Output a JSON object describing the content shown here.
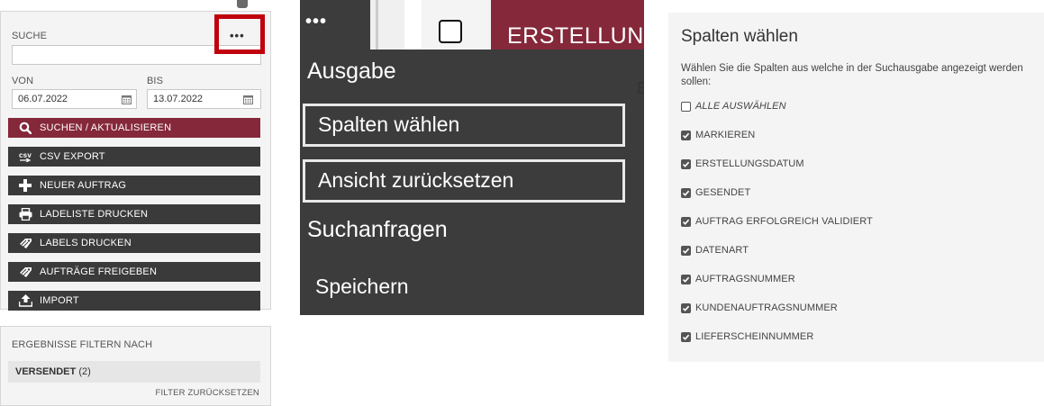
{
  "search_panel": {
    "search_label": "SUCHE",
    "menu_dots": "•••",
    "search_value": "",
    "from_label": "VON",
    "to_label": "BIS",
    "from_date": "06.07.2022",
    "to_date": "13.07.2022",
    "buttons": [
      {
        "label": "SUCHEN / AKTUALISIEREN",
        "icon": "search-icon"
      },
      {
        "label": "CSV EXPORT",
        "icon": "csv-icon"
      },
      {
        "label": "NEUER AUFTRAG",
        "icon": "plus-icon"
      },
      {
        "label": "LADELISTE DRUCKEN",
        "icon": "printer-icon"
      },
      {
        "label": "LABELS DRUCKEN",
        "icon": "label-icon"
      },
      {
        "label": "AUFTRÄGE FREIGEBEN",
        "icon": "label-icon"
      },
      {
        "label": "IMPORT",
        "icon": "upload-icon"
      }
    ],
    "csv_icon_text": "csv",
    "filter_heading": "ERGEBNISSE FILTERN NACH",
    "filter_item_label": "VERSENDET",
    "filter_item_count": "(2)",
    "filter_reset": "FILTER ZURÜCKSETZEN",
    "highlight_color": "#c0000c",
    "accent_color": "#85283a"
  },
  "context_menu": {
    "dots": "•••",
    "header_title": "ERSTELLUNG",
    "section_output": "Ausgabe",
    "item_choose_columns": "Spalten wählen",
    "item_reset_view": "Ansicht zurücksetzen",
    "section_queries": "Suchanfragen",
    "item_save": "Speichern",
    "edge_text": "E"
  },
  "column_chooser": {
    "title": "Spalten wählen",
    "description": "Wählen Sie die Spalten aus welche in der Suchausgabe angezeigt werden sollen:",
    "select_all": {
      "label": "ALLE AUSWÄHLEN",
      "checked": false
    },
    "columns": [
      {
        "label": "MARKIEREN",
        "checked": true
      },
      {
        "label": "ERSTELLUNGSDATUM",
        "checked": true
      },
      {
        "label": "GESENDET",
        "checked": true
      },
      {
        "label": "AUFTRAG ERFOLGREICH VALIDIERT",
        "checked": true
      },
      {
        "label": "DATENART",
        "checked": true
      },
      {
        "label": "AUFTRAGSNUMMER",
        "checked": true
      },
      {
        "label": "KUNDENAUFTRAGSNUMMER",
        "checked": true
      },
      {
        "label": "LIEFERSCHEINNUMMER",
        "checked": true
      }
    ]
  }
}
